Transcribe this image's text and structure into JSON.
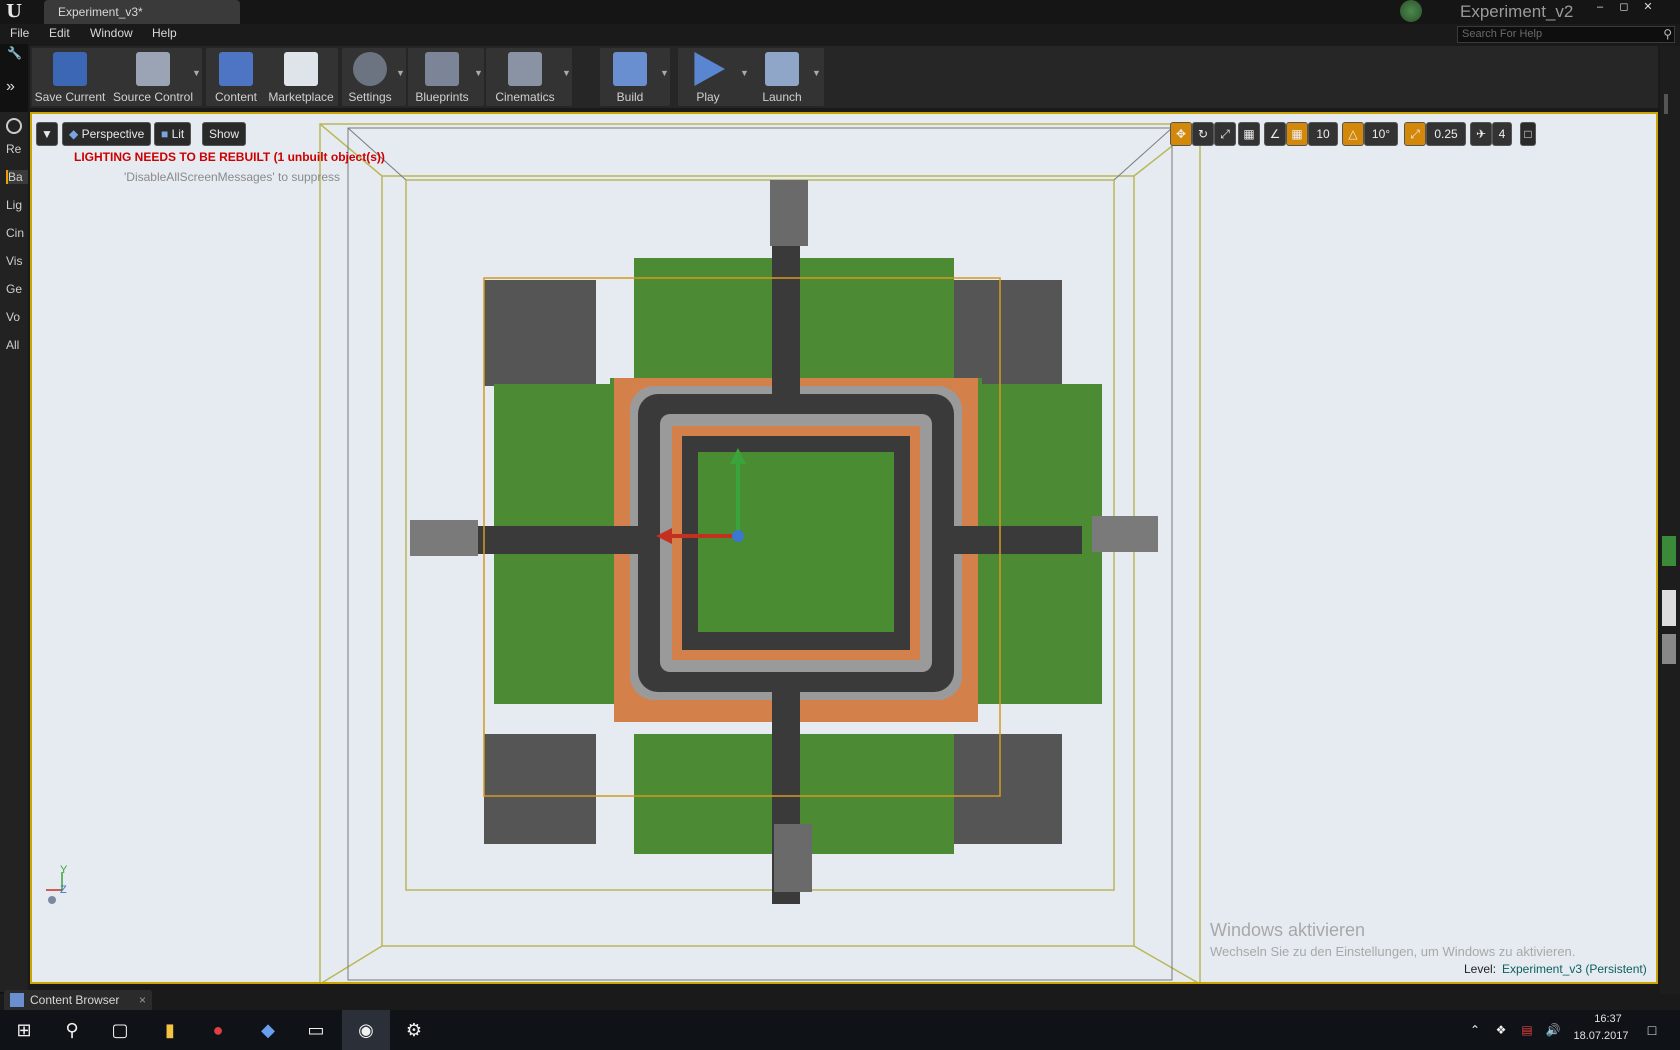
{
  "window": {
    "document_tab": "Experiment_v3*",
    "project_name": "Experiment_v2",
    "search_placeholder": "Search For Help"
  },
  "menu": [
    "File",
    "Edit",
    "Window",
    "Help"
  ],
  "toolbar": {
    "buttons": [
      {
        "label": "Save Current",
        "icon": "save-icon"
      },
      {
        "label": "Source Control",
        "icon": "source-control-icon"
      },
      {
        "label": "Content",
        "icon": "content-icon"
      },
      {
        "label": "Marketplace",
        "icon": "marketplace-icon"
      },
      {
        "label": "Settings",
        "icon": "settings-icon"
      },
      {
        "label": "Blueprints",
        "icon": "blueprints-icon"
      },
      {
        "label": "Cinematics",
        "icon": "cinematics-icon"
      },
      {
        "label": "Build",
        "icon": "build-icon"
      },
      {
        "label": "Play",
        "icon": "play-icon"
      },
      {
        "label": "Launch",
        "icon": "launch-icon"
      }
    ]
  },
  "place_panel": {
    "items": [
      "Re",
      "Ba",
      "Lig",
      "Cin",
      "Vis",
      "Ge",
      "Vo",
      "All"
    ]
  },
  "viewport": {
    "perspective_label": "Perspective",
    "lit_label": "Lit",
    "show_label": "Show",
    "lighting_warning": "LIGHTING NEEDS TO BE REBUILT (1 unbuilt object(s))",
    "suppress_note": "'DisableAllScreenMessages' to suppress",
    "grid_snap": "10",
    "rotation_snap": "10°",
    "scale_snap": "0.25",
    "camera_speed": "4",
    "windows_activate_title": "Windows aktivieren",
    "windows_activate_sub": "Wechseln Sie zu den Einstellungen, um Windows zu aktivieren.",
    "level_label": "Level:",
    "level_value": "Experiment_v3 (Persistent)",
    "axis_y": "Y",
    "axis_z": "Z"
  },
  "content_browser_tab": "Content Browser",
  "taskbar": {
    "time": "16:37",
    "date": "18.07.2017"
  },
  "colors": {
    "viewport_bg": "#e6ebf1",
    "selection_yellow": "#caa400",
    "warning_red": "#cc0000",
    "grass": "#4d8a34",
    "road": "#3a3a3a"
  }
}
